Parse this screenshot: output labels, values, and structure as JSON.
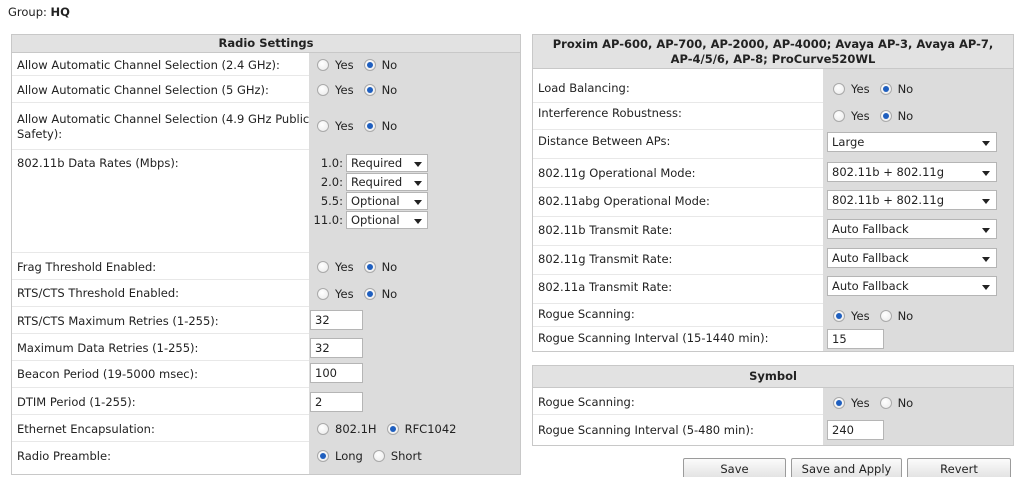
{
  "group": {
    "label": "Group:",
    "name": "HQ"
  },
  "radio_settings": {
    "title": "Radio Settings",
    "yes": "Yes",
    "no": "No",
    "auto_24": "Allow Automatic Channel Selection (2.4 GHz):",
    "auto_5": "Allow Automatic Channel Selection (5 GHz):",
    "auto_49_line1": "Allow Automatic Channel Selection (4.9 GHz Public",
    "auto_49_line2": "Safety):",
    "data_rates_label": "802.11b Data Rates (Mbps):",
    "data_rates": [
      {
        "rate": "1.0:",
        "value": "Required"
      },
      {
        "rate": "2.0:",
        "value": "Required"
      },
      {
        "rate": "5.5:",
        "value": "Optional"
      },
      {
        "rate": "11.0:",
        "value": "Optional"
      }
    ],
    "frag_label": "Frag Threshold Enabled:",
    "rts_label": "RTS/CTS Threshold Enabled:",
    "rts_retries_label": "RTS/CTS Maximum Retries (1-255):",
    "rts_retries_value": "32",
    "max_retries_label": "Maximum Data Retries (1-255):",
    "max_retries_value": "32",
    "beacon_label": "Beacon Period (19-5000 msec):",
    "beacon_value": "100",
    "dtim_label": "DTIM Period (1-255):",
    "dtim_value": "2",
    "eth_label": "Ethernet Encapsulation:",
    "eth_opt1": "802.1H",
    "eth_opt2": "RFC1042",
    "preamble_label": "Radio Preamble:",
    "preamble_opt1": "Long",
    "preamble_opt2": "Short"
  },
  "proxim": {
    "title_line1": "Proxim AP-600, AP-700, AP-2000, AP-4000; Avaya AP-3, Avaya AP-7,",
    "title_line2": "AP-4/5/6, AP-8; ProCurve520WL",
    "yes": "Yes",
    "no": "No",
    "load_label": "Load Balancing:",
    "interf_label": "Interference Robustness:",
    "distance_label": "Distance Between APs:",
    "distance_value": "Large",
    "g_mode_label": "802.11g Operational Mode:",
    "g_mode_value": "802.11b + 802.11g",
    "abg_mode_label": "802.11abg Operational Mode:",
    "abg_mode_value": "802.11b + 802.11g",
    "b_tx_label": "802.11b Transmit Rate:",
    "b_tx_value": "Auto Fallback",
    "g_tx_label": "802.11g Transmit Rate:",
    "g_tx_value": "Auto Fallback",
    "a_tx_label": "802.11a Transmit Rate:",
    "a_tx_value": "Auto Fallback",
    "rogue_label": "Rogue Scanning:",
    "rogue_int_label": "Rogue Scanning Interval (15-1440 min):",
    "rogue_int_value": "15"
  },
  "symbol": {
    "title": "Symbol",
    "yes": "Yes",
    "no": "No",
    "rogue_label": "Rogue Scanning:",
    "rogue_int_label": "Rogue Scanning Interval (5-480 min):",
    "rogue_int_value": "240"
  },
  "buttons": {
    "save": "Save",
    "save_apply": "Save and Apply",
    "revert": "Revert"
  }
}
